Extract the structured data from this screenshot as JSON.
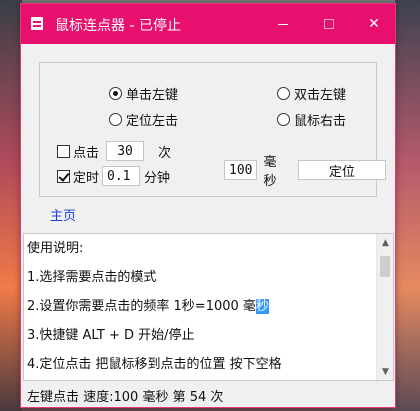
{
  "window": {
    "title": "鼠标连点器 - 已停止",
    "controls": {
      "minimize": "",
      "maximize": "",
      "close": "✕"
    }
  },
  "mode": {
    "options": [
      {
        "label": "单击左键",
        "selected": true
      },
      {
        "label": "双击左键",
        "selected": false
      },
      {
        "label": "定位左击",
        "selected": false
      },
      {
        "label": "鼠标右击",
        "selected": false
      }
    ]
  },
  "click_count": {
    "label": "点击",
    "checked": false,
    "value": "30",
    "unit": "次"
  },
  "timer": {
    "label": "定时",
    "checked": true,
    "value": "0.1",
    "unit": "分钟"
  },
  "interval": {
    "value": "100",
    "unit": "毫秒"
  },
  "locate_button": "定位",
  "home_link": "主页",
  "instructions": {
    "lines": [
      "使用说明:",
      "1.选择需要点击的模式",
      "2.设置你需要点击的频率 1秒=1000 毫",
      "3.快捷键 ALT + D 开始/停止",
      "4.定位点击 把鼠标移到点击的位置 按下空格"
    ],
    "selected_text": "秒"
  },
  "status": "左键点击 速度:100 毫秒 第 54 次"
}
